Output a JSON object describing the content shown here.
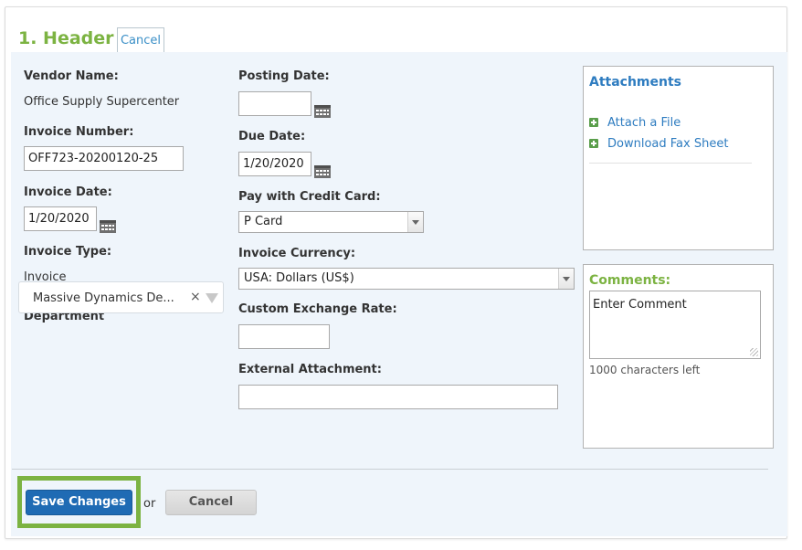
{
  "header": {
    "title": "1. Header",
    "cancel_label": "Cancel"
  },
  "fields": {
    "vendor_name": {
      "label": "Vendor Name:",
      "value": "Office Supply Supercenter"
    },
    "invoice_number": {
      "label": "Invoice Number:",
      "value": "OFF723-20200120-25"
    },
    "invoice_date": {
      "label": "Invoice Date:",
      "value": "1/20/2020"
    },
    "invoice_type": {
      "label": "Invoice Type:",
      "value": "Invoice"
    },
    "department": {
      "label": "Department",
      "value": "Massive Dynamics De...",
      "clear": "×"
    },
    "posting_date": {
      "label": "Posting Date:",
      "value": ""
    },
    "due_date": {
      "label": "Due Date:",
      "value": "1/20/2020"
    },
    "credit_card": {
      "label": "Pay with Credit Card:",
      "value": "P Card"
    },
    "currency": {
      "label": "Invoice Currency:",
      "value": "USA: Dollars (US$)"
    },
    "exchange_rate": {
      "label": "Custom Exchange Rate:",
      "value": ""
    },
    "external_attachment": {
      "label": "External Attachment:",
      "value": ""
    }
  },
  "attachments": {
    "title": "Attachments",
    "links": [
      "Attach a File",
      "Download Fax Sheet"
    ]
  },
  "comments": {
    "title": "Comments:",
    "placeholder": "Enter Comment",
    "chars_left": "1000 characters left"
  },
  "footer": {
    "save_label": "Save Changes",
    "or_label": "or",
    "cancel_label": "Cancel"
  },
  "colors": {
    "accent_green": "#7cb342",
    "link_blue": "#2e7cc0",
    "primary_button": "#1f6bb4",
    "panel_bg": "#eff5fb"
  }
}
